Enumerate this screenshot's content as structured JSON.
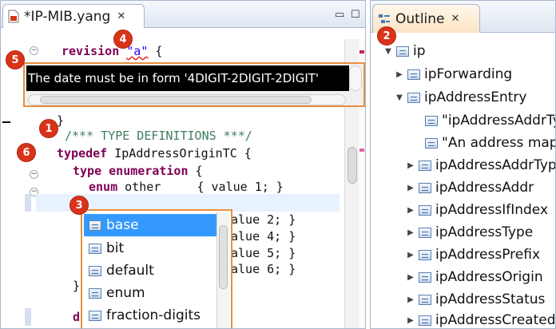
{
  "editor": {
    "tab_title": "*IP-MIB.yang",
    "code": {
      "l1_kw": "revision",
      "l1_str": "\"a\"",
      "l1_rest": " {",
      "l5": "}",
      "l6": "/*** TYPE DEFINITIONS ***/",
      "l7_kw": "typedef",
      "l7_rest": " IpAddressOriginTC {",
      "l8_kw": "type enumeration",
      "l8_rest": " {",
      "l9_kw": "enum",
      "l9_rest": " other     { value 1; }",
      "l11": "alue 2; }",
      "l12": "alue 4; }",
      "l13": "alue 5; }",
      "l14": "alue 6; }",
      "l15": "}",
      "l16": "d"
    },
    "tooltip_text": "The date must be in form '4DIGIT-2DIGIT-2DIGIT'",
    "completion_items": [
      "base",
      "bit",
      "default",
      "enum",
      "fraction-digits"
    ]
  },
  "outline": {
    "tab_title": "Outline",
    "items": [
      {
        "label": "ip",
        "twisty": "▼"
      },
      {
        "label": "ipForwarding",
        "twisty": "▶"
      },
      {
        "label": "ipAddressEntry",
        "twisty": "▼"
      },
      {
        "label": "\"ipAddressAddrTy",
        "twisty": ""
      },
      {
        "label": "\"An address mappi",
        "twisty": ""
      },
      {
        "label": "ipAddressAddrTyp",
        "twisty": "▶"
      },
      {
        "label": "ipAddressAddr",
        "twisty": "▶"
      },
      {
        "label": "ipAddressIfIndex",
        "twisty": "▶"
      },
      {
        "label": "ipAddressType",
        "twisty": "▶"
      },
      {
        "label": "ipAddressPrefix",
        "twisty": "▶"
      },
      {
        "label": "ipAddressOrigin",
        "twisty": "▶"
      },
      {
        "label": "ipAddressStatus",
        "twisty": "▶"
      },
      {
        "label": "ipAddressCreated",
        "twisty": "▶"
      }
    ]
  },
  "callouts": {
    "c1": "1",
    "c2": "2",
    "c3": "3",
    "c4": "4",
    "c5": "5",
    "c6": "6"
  },
  "colors": {
    "callout": "#d9331a",
    "popup_border": "#e8903e",
    "keyword": "#7f0055",
    "comment": "#3f7f5f",
    "string": "#2a00ff",
    "selection": "#3399ff"
  }
}
